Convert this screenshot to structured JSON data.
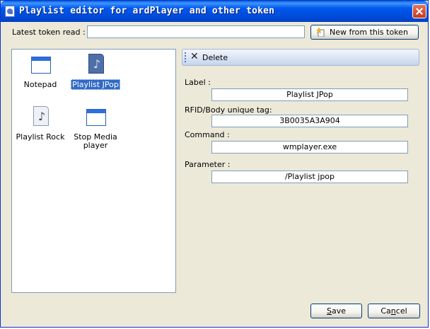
{
  "window": {
    "title": "Playlist editor for ardPlayer and other token",
    "colors": {
      "titlebar": "#0058ee",
      "face": "#ece9d8",
      "selection": "#316ac5"
    }
  },
  "token": {
    "label": "Latest token read :",
    "value": "",
    "new_button": "New from this token"
  },
  "items": [
    {
      "label": "Notepad",
      "icon": "window-icon",
      "selected": false
    },
    {
      "label": "Playlist JPop",
      "icon": "music-note-icon",
      "selected": true
    },
    {
      "label": "Playlist Rock",
      "icon": "music-note-icon",
      "selected": false
    },
    {
      "label": "Stop Media player",
      "icon": "window-icon",
      "selected": false
    }
  ],
  "toolbar": {
    "delete_label": "Delete"
  },
  "fields": {
    "label": {
      "caption": "Label :",
      "value": "Playlist JPop"
    },
    "rfid": {
      "caption": "RFID/Body unique tag:",
      "value": "3B0035A3A904"
    },
    "command": {
      "caption": "Command :",
      "value": "wmplayer.exe"
    },
    "parameter": {
      "caption": "Parameter :",
      "value": "/Playlist jpop"
    }
  },
  "buttons": {
    "save_pre": "",
    "save_key": "S",
    "save_post": "ave",
    "cancel_pre": "Ca",
    "cancel_key": "n",
    "cancel_post": "cel"
  }
}
